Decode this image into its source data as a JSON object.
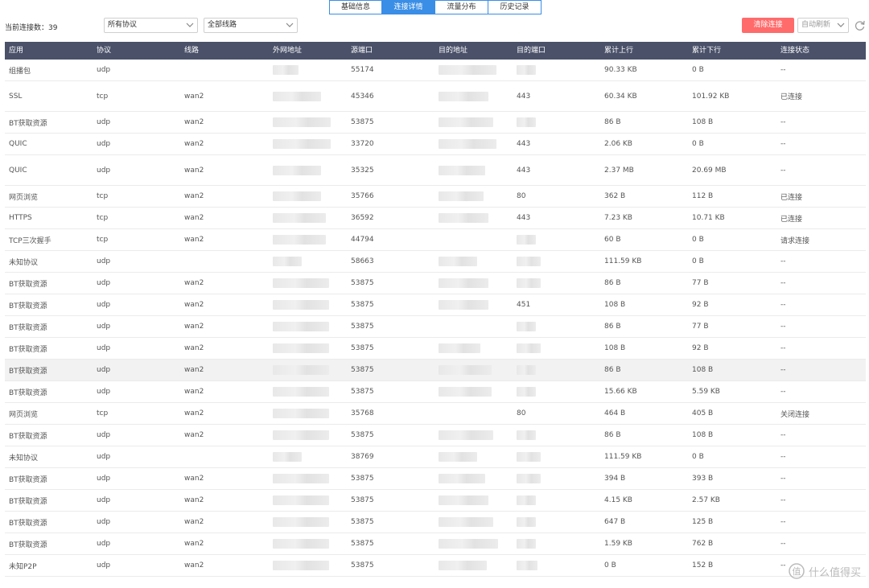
{
  "tabs": [
    {
      "label": "基础信息",
      "active": false
    },
    {
      "label": "连接详情",
      "active": true
    },
    {
      "label": "流量分布",
      "active": false
    },
    {
      "label": "历史记录",
      "active": false
    }
  ],
  "toolbar": {
    "connection_count_label": "当前连接数：39",
    "protocol_filter": "所有协议",
    "line_filter": "全部线路",
    "clear_button": "清除连接",
    "auto_refresh": "自动刷新"
  },
  "colors": {
    "accent": "#3a8ee6",
    "header_bg": "#4a5169",
    "danger": "#ff6b6b"
  },
  "table": {
    "headers": [
      "应用",
      "协议",
      "线路",
      "外网地址",
      "源端口",
      "目的地址",
      "目的端口",
      "累计上行",
      "累计下行",
      "连接状态"
    ],
    "rows": [
      [
        "组播包",
        "udp",
        "",
        "",
        "55174",
        "",
        "",
        "90.33 KB",
        "0 B",
        "--"
      ],
      [
        "SSL",
        "tcp",
        "wan2",
        "",
        "45346",
        "",
        "443",
        "60.34 KB",
        "101.92 KB",
        "已连接"
      ],
      [
        "BT获取资源",
        "udp",
        "wan2",
        "",
        "53875",
        "",
        "",
        "86 B",
        "108 B",
        "--"
      ],
      [
        "QUIC",
        "udp",
        "wan2",
        "",
        "33720",
        "",
        "443",
        "2.06 KB",
        "0 B",
        "--"
      ],
      [
        "QUIC",
        "udp",
        "wan2",
        "",
        "35325",
        "",
        "443",
        "2.37 MB",
        "20.69 MB",
        "--"
      ],
      [
        "网页浏览",
        "tcp",
        "wan2",
        "",
        "35766",
        "",
        "80",
        "362 B",
        "112 B",
        "已连接"
      ],
      [
        "HTTPS",
        "tcp",
        "wan2",
        "",
        "36592",
        "",
        "443",
        "7.23 KB",
        "10.71 KB",
        "已连接"
      ],
      [
        "TCP三次握手",
        "tcp",
        "wan2",
        "",
        "44794",
        "",
        "",
        "60 B",
        "0 B",
        "请求连接"
      ],
      [
        "未知协议",
        "udp",
        "",
        "",
        "58663",
        "",
        "",
        "111.59 KB",
        "0 B",
        "--"
      ],
      [
        "BT获取资源",
        "udp",
        "wan2",
        "",
        "53875",
        "",
        "",
        "86 B",
        "77 B",
        "--"
      ],
      [
        "BT获取资源",
        "udp",
        "wan2",
        "",
        "53875",
        "",
        "451",
        "108 B",
        "92 B",
        "--"
      ],
      [
        "BT获取资源",
        "udp",
        "wan2",
        "",
        "53875",
        "",
        "",
        "86 B",
        "77 B",
        "--"
      ],
      [
        "BT获取资源",
        "udp",
        "wan2",
        "",
        "53875",
        "",
        "",
        "108 B",
        "92 B",
        "--"
      ],
      [
        "BT获取资源",
        "udp",
        "wan2",
        "",
        "53875",
        "",
        "",
        "86 B",
        "108 B",
        "--"
      ],
      [
        "BT获取资源",
        "udp",
        "wan2",
        "",
        "53875",
        "",
        "",
        "15.66 KB",
        "5.59 KB",
        "--"
      ],
      [
        "网页浏览",
        "tcp",
        "wan2",
        "",
        "35768",
        "",
        "80",
        "464 B",
        "405 B",
        "关闭连接"
      ],
      [
        "BT获取资源",
        "udp",
        "wan2",
        "",
        "53875",
        "",
        "",
        "86 B",
        "108 B",
        "--"
      ],
      [
        "未知协议",
        "udp",
        "",
        "",
        "38769",
        "",
        "",
        "111.59 KB",
        "0 B",
        "--"
      ],
      [
        "BT获取资源",
        "udp",
        "wan2",
        "",
        "53875",
        "",
        "",
        "394 B",
        "393 B",
        "--"
      ],
      [
        "BT获取资源",
        "udp",
        "wan2",
        "",
        "53875",
        "",
        "",
        "4.15 KB",
        "2.57 KB",
        "--"
      ],
      [
        "BT获取资源",
        "udp",
        "wan2",
        "",
        "53875",
        "",
        "",
        "647 B",
        "125 B",
        "--"
      ],
      [
        "BT获取资源",
        "udp",
        "wan2",
        "",
        "53875",
        "",
        "",
        "1.59 KB",
        "762 B",
        "--"
      ],
      [
        "未知P2P",
        "udp",
        "wan2",
        "",
        "53875",
        "",
        "",
        "0 B",
        "152 B",
        "--"
      ]
    ]
  },
  "watermark": "什么值得买"
}
